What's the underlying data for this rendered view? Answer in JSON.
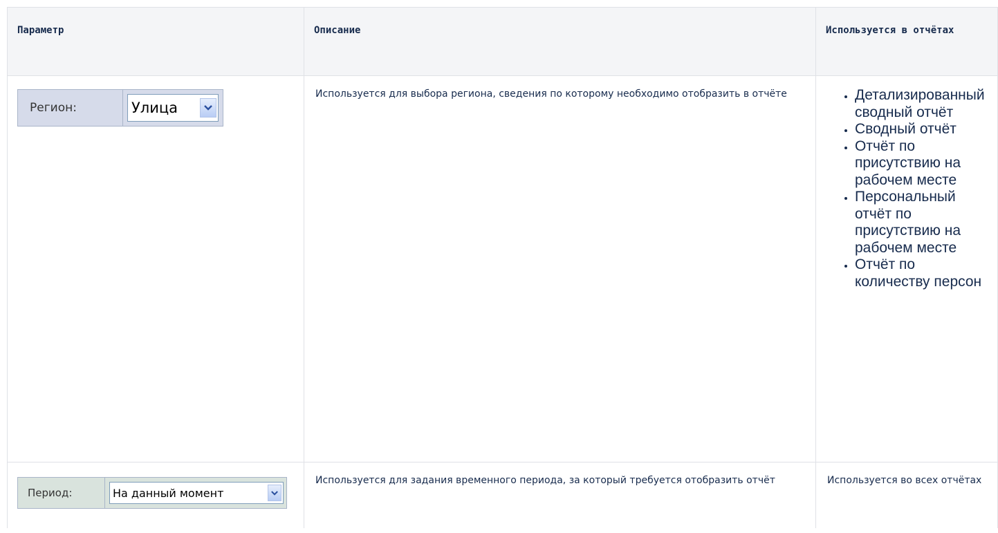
{
  "table": {
    "headers": [
      "Параметр",
      "Описание",
      "Используется в отчётах"
    ],
    "rows": [
      {
        "widget": {
          "label": "Регион:",
          "value": "Улица",
          "dropdown_icon": "chevron-down-icon",
          "background": "#d6dbea"
        },
        "description": "Используется для выбора региона, сведения по которому необходимо отобразить в отчёте",
        "reports": [
          "Детализированный сводный отчёт",
          "Сводный отчёт",
          "Отчёт по присутствию на рабочем месте",
          "Персональный отчёт по присутствию на рабочем месте",
          "Отчёт по количеству персон"
        ]
      },
      {
        "widget": {
          "label": "Период:",
          "value": "На данный момент",
          "dropdown_icon": "chevron-down-icon",
          "background": "#d9e3dd"
        },
        "description": "Используется для задания временного периода, за который требуется отобразить отчёт",
        "reports_text": "Используется во всех отчётах"
      }
    ]
  },
  "colors": {
    "header_bg": "#f4f5f7",
    "border": "#dfe1e6",
    "text": "#172b4d"
  }
}
